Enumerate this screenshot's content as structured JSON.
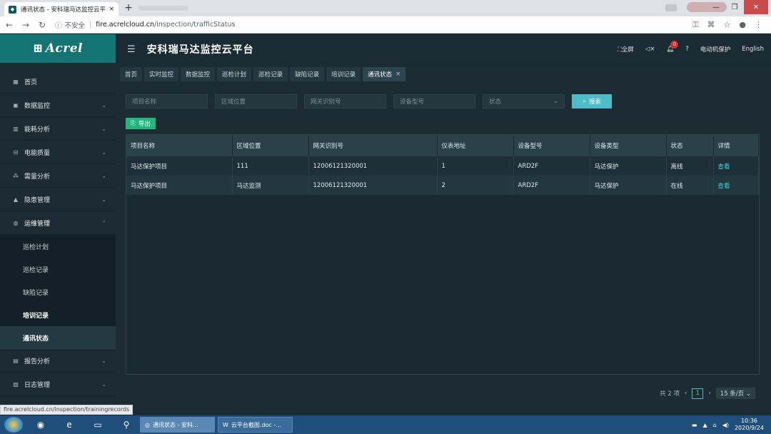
{
  "browser": {
    "tab_title": "通讯状态 - 安科瑞马达监控云平台",
    "tab_close": "×",
    "new_tab": "+",
    "security_label": "不安全",
    "url_host": "fire.acrelcloud.cn",
    "url_path": "/inspection/trafficStatus"
  },
  "sidebar": {
    "logo": "Acrel",
    "logo_mark": "",
    "items": [
      {
        "label": "首页",
        "icon": "home-icon"
      },
      {
        "label": "数据监控",
        "icon": "monitor-icon"
      },
      {
        "label": "能耗分析",
        "icon": "bar-chart-icon"
      },
      {
        "label": "电能质量",
        "icon": "power-quality-icon"
      },
      {
        "label": "需量分析",
        "icon": "demand-icon"
      },
      {
        "label": "隐患管理",
        "icon": "warning-icon"
      },
      {
        "label": "运维管理",
        "icon": "ops-icon"
      }
    ],
    "sub_items": [
      "巡检计划",
      "巡检记录",
      "缺陷记录",
      "培训记录",
      "通讯状态"
    ],
    "bottom_items": [
      {
        "label": "报告分析",
        "icon": "report-icon"
      },
      {
        "label": "日志管理",
        "icon": "log-icon"
      }
    ]
  },
  "header": {
    "title": "安科瑞马达监控云平台",
    "fullscreen": "全屏",
    "notification_count": "0",
    "module": "电动机保护",
    "language": "English"
  },
  "page_tabs": [
    "首页",
    "实时监控",
    "数据监控",
    "巡检计划",
    "巡检记录",
    "缺陷记录",
    "培训记录",
    "通讯状态"
  ],
  "filters": {
    "project_name": "项目名称",
    "region": "区域位置",
    "gateway_id": "网关识别号",
    "device_model": "设备型号",
    "status": "状态",
    "search": "搜索",
    "export": "导出"
  },
  "table": {
    "columns": [
      "项目名称",
      "区域位置",
      "网关识别号",
      "仪表地址",
      "设备型号",
      "设备类型",
      "状态",
      "详情"
    ],
    "rows": [
      [
        "马达保护项目",
        "111",
        "12006121320001",
        "1",
        "ARD2F",
        "马达保护",
        "离线",
        "查看"
      ],
      [
        "马达保护项目",
        "马达监测",
        "12006121320001",
        "2",
        "ARD2F",
        "马达保护",
        "在线",
        "查看"
      ]
    ]
  },
  "pager": {
    "total": "共 2 项",
    "current": "1",
    "page_size": "15 条/页"
  },
  "status_bar": "fire.acrelcloud.cn/inspection/trainingrecords",
  "taskbar": {
    "task1": "通讯状态 - 安科...",
    "task2": "云平台截图.doc -...",
    "time": "10:36",
    "date": "2020/9/24"
  }
}
